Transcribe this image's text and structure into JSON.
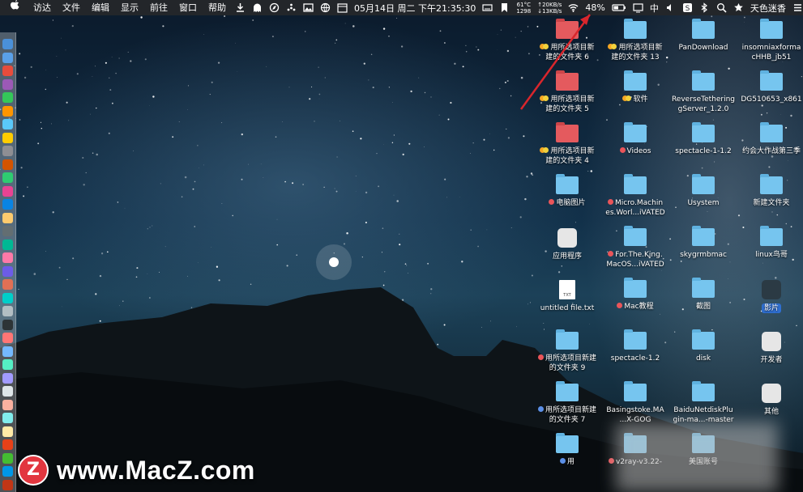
{
  "menubar": {
    "apple": "",
    "menus": [
      "访达",
      "文件",
      "编辑",
      "显示",
      "前往",
      "窗口",
      "帮助"
    ],
    "status": {
      "temp_line1": "61°C",
      "temp_line2": "1298",
      "net_up": "↑20KB/s",
      "net_down": "↓13KB/s",
      "datetime": "05月14日 周二 下午21:35:30",
      "battery": "48%",
      "input_method": "中",
      "user": "天色迷香"
    }
  },
  "desktop": {
    "icons": [
      {
        "label": "用所选项目新建的文件夹 6",
        "line1": "用所选项目新",
        "line2": "建的文件夹 6",
        "tag": "orange",
        "kind": "folder-red"
      },
      {
        "label": "用所选项目新建的文件夹 13",
        "line1": "用所选项目新",
        "line2": "建的文件夹 13",
        "tag": "orange",
        "kind": "folder"
      },
      {
        "label": "PanDownload",
        "line1": "PanDownload",
        "line2": "",
        "tag": "",
        "kind": "folder"
      },
      {
        "label": "insomniaxformacHHB_jb51",
        "line1": "insomniaxforma",
        "line2": "cHHB_jb51",
        "tag": "",
        "kind": "folder"
      },
      {
        "label": "用所选项目新建的文件夹 5",
        "line1": "用所选项目新",
        "line2": "建的文件夹 5",
        "tag": "orange",
        "kind": "folder-red"
      },
      {
        "label": "软件",
        "line1": "软件",
        "line2": "",
        "tag": "orange",
        "kind": "folder"
      },
      {
        "label": "ReverseTetheringServer_1.2.0",
        "line1": "ReverseTethering",
        "line2": "gServer_1.2.0",
        "tag": "",
        "kind": "folder"
      },
      {
        "label": "DG510653_x86",
        "line1": "DG510653_x861",
        "line2": "",
        "tag": "",
        "kind": "folder"
      },
      {
        "label": "用所选项目新建的文件夹 4",
        "line1": "用所选项目新",
        "line2": "建的文件夹 4",
        "tag": "orange",
        "kind": "folder-red"
      },
      {
        "label": "Videos",
        "line1": "Videos",
        "line2": "",
        "tag": "red",
        "kind": "folder"
      },
      {
        "label": "spectacle-1-1.2",
        "line1": "spectacle-1-1.2",
        "line2": "",
        "tag": "",
        "kind": "folder"
      },
      {
        "label": "约会大作战第三季",
        "line1": "约会大作战第三季",
        "line2": "",
        "tag": "",
        "kind": "folder"
      },
      {
        "label": "电脑图片",
        "line1": "电脑图片",
        "line2": "",
        "tag": "red",
        "kind": "folder"
      },
      {
        "label": "Micro.Machines.Worl...iVATED",
        "line1": "Micro.Machin",
        "line2": "es.Worl...iVATED",
        "tag": "red",
        "kind": "folder"
      },
      {
        "label": "Usystem",
        "line1": "Usystem",
        "line2": "",
        "tag": "",
        "kind": "folder"
      },
      {
        "label": "新建文件夹",
        "line1": "新建文件夹",
        "line2": "",
        "tag": "",
        "kind": "folder"
      },
      {
        "label": "应用程序",
        "line1": "应用程序",
        "line2": "",
        "tag": "",
        "kind": "app"
      },
      {
        "label": "For.The.King.MacOS...iVATED",
        "line1": "For.The.King.",
        "line2": "MacOS...iVATED",
        "tag": "red",
        "kind": "folder"
      },
      {
        "label": "skygrmbmac",
        "line1": "skygrmbmac",
        "line2": "",
        "tag": "",
        "kind": "folder"
      },
      {
        "label": "linux鸟哥",
        "line1": "linux鸟哥",
        "line2": "",
        "tag": "",
        "kind": "folder"
      },
      {
        "label": "untitled file.txt",
        "line1": "untitled file.txt",
        "line2": "",
        "tag": "",
        "kind": "doc"
      },
      {
        "label": "Mac教程",
        "line1": "Mac教程",
        "line2": "",
        "tag": "red",
        "kind": "folder"
      },
      {
        "label": "截图",
        "line1": "截图",
        "line2": "",
        "tag": "",
        "kind": "folder"
      },
      {
        "label": "影片",
        "line1": "影片",
        "line2": "",
        "tag": "",
        "kind": "movies",
        "selected": true
      },
      {
        "label": "用所选项目新建的文件夹 9",
        "line1": "用所选项目新建",
        "line2": "的文件夹 9",
        "tag": "red",
        "kind": "folder"
      },
      {
        "label": "spectacle-1.2",
        "line1": "spectacle-1.2",
        "line2": "",
        "tag": "",
        "kind": "folder"
      },
      {
        "label": "disk",
        "line1": "disk",
        "line2": "",
        "tag": "",
        "kind": "folder"
      },
      {
        "label": "开发者",
        "line1": "开发者",
        "line2": "",
        "tag": "",
        "kind": "app"
      },
      {
        "label": "用所选项目新建的文件夹 7",
        "line1": "用所选项目新建",
        "line2": "的文件夹 7",
        "tag": "blue",
        "kind": "folder"
      },
      {
        "label": "Basingstoke.MA...X-GOG",
        "line1": "Basingstoke.MA",
        "line2": "...X-GOG",
        "tag": "",
        "kind": "folder"
      },
      {
        "label": "BaiduNetdiskPlugin-ma...-master",
        "line1": "BaiduNetdiskPlu",
        "line2": "gin-ma...-master",
        "tag": "",
        "kind": "folder"
      },
      {
        "label": "其他",
        "line1": "其他",
        "line2": "",
        "tag": "",
        "kind": "app"
      },
      {
        "label": "用",
        "line1": "用",
        "line2": "",
        "tag": "blue",
        "kind": "folder"
      },
      {
        "label": "v2ray-v3.22-",
        "line1": "v2ray-v3.22-",
        "line2": "",
        "tag": "red",
        "kind": "folder"
      },
      {
        "label": "美国账号",
        "line1": "美国账号",
        "line2": "",
        "tag": "",
        "kind": "folder"
      }
    ]
  },
  "watermark": {
    "logo": "Z",
    "text": "www.MacZ.com"
  },
  "colors": {
    "accent": "#e2363f",
    "folder": "#76c5ef",
    "selection": "#2f6fd1"
  }
}
